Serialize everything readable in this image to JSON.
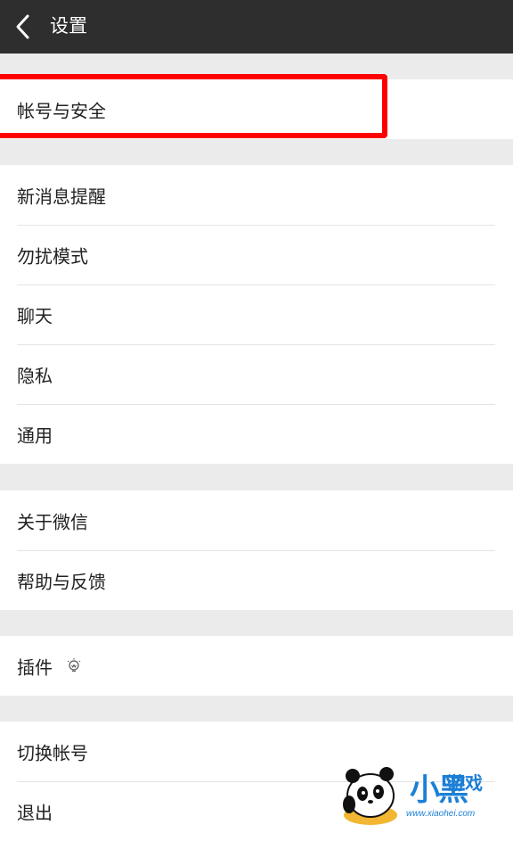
{
  "header": {
    "title": "设置",
    "back_icon": "chevron-left-icon"
  },
  "groups": [
    {
      "items": [
        "帐号与安全"
      ]
    },
    {
      "items": [
        "新消息提醒",
        "勿扰模式",
        "聊天",
        "隐私",
        "通用"
      ]
    },
    {
      "items": [
        "关于微信",
        "帮助与反馈"
      ]
    },
    {
      "items": [
        "插件"
      ],
      "plugin_icon": "lightbulb-icon"
    },
    {
      "items": [
        "切换帐号",
        "退出"
      ]
    }
  ],
  "highlight": {
    "color": "#ff0000",
    "target": "帐号与安全"
  },
  "watermark": {
    "title": "小黑",
    "subtitle": "游戏",
    "url": "www.xiaohei.com"
  },
  "colors": {
    "header_bg": "#2e2e2e",
    "page_bg": "#ebebeb",
    "row_bg": "#ffffff",
    "accent": "#1c7fd6"
  }
}
